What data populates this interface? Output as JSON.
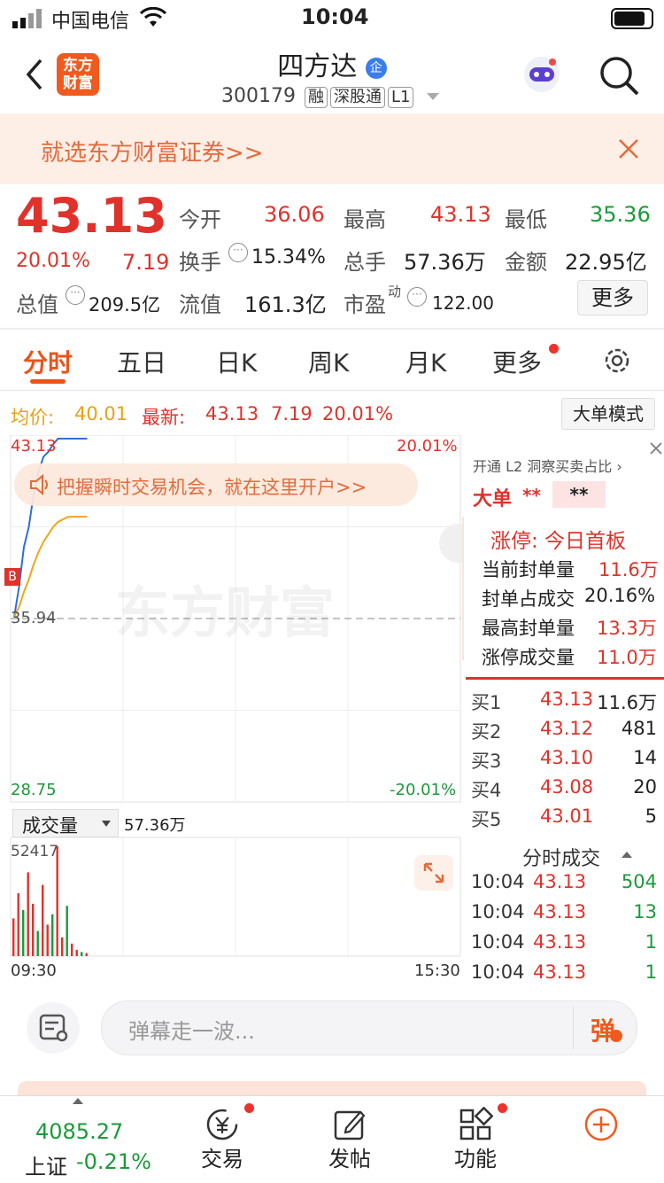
{
  "status": {
    "carrier": "中国电信",
    "time": "10:04"
  },
  "header": {
    "logo_line1": "东方",
    "logo_line2": "财富",
    "stock_name": "四方达",
    "badge": "企",
    "code": "300179",
    "chips": [
      "融",
      "深股通",
      "L1"
    ]
  },
  "banner": {
    "text": "就选东方财富证券>>"
  },
  "quote": {
    "price": "43.13",
    "pct": "20.01%",
    "change": "7.19",
    "open_label": "今开",
    "open": "36.06",
    "high_label": "最高",
    "high": "43.13",
    "low_label": "最低",
    "low": "35.36",
    "turnover_label": "换手",
    "turnover": "15.34%",
    "vol_label": "总手",
    "vol": "57.36万",
    "amount_label": "金额",
    "amount": "22.95亿",
    "mktcap_label": "总值",
    "mktcap": "209.5亿",
    "float_label": "流值",
    "float": "161.3亿",
    "pe_label": "市盈",
    "pe_sup": "动",
    "pe": "122.00",
    "more": "更多"
  },
  "tabs": [
    "分时",
    "五日",
    "日K",
    "周K",
    "月K",
    "更多"
  ],
  "info": {
    "avg_label": "均价:",
    "avg": "40.01",
    "latest_label": "最新:",
    "latest": "43.13",
    "latest_chg": "7.19",
    "latest_pct": "20.01%",
    "mode_button": "大单模式"
  },
  "chart": {
    "top_price": "43.13",
    "top_pct": "20.01%",
    "mid_price": "35.94",
    "bottom_price": "28.75",
    "bottom_pct": "-20.01%",
    "ad_text": "把握瞬时交易机会，就在这里开户>>",
    "watermark": "东方财富",
    "b_marker": "B",
    "volume_selector": "成交量",
    "volume_total": "57.36万",
    "volume_max": "52417",
    "time_start": "09:30",
    "time_end": "15:30"
  },
  "chart_data": {
    "type": "line",
    "x": [
      "09:30",
      "09:31",
      "09:32",
      "09:33",
      "09:34",
      "09:35",
      "09:36",
      "09:37",
      "09:38",
      "09:39",
      "09:40",
      "09:41",
      "09:42",
      "09:43",
      "09:44",
      "09:45"
    ],
    "ylim": [
      28.75,
      43.13
    ],
    "series": [
      {
        "color": "#2c6fd6",
        "values": [
          36.0,
          37.2,
          38.8,
          39.6,
          40.9,
          41.8,
          42.4,
          42.6,
          42.9,
          43.13,
          43.13,
          43.13,
          43.13,
          43.13,
          43.13,
          43.13
        ]
      },
      {
        "color": "#f2a516",
        "values": [
          36.0,
          36.4,
          37.0,
          37.5,
          38.1,
          38.6,
          39.0,
          39.3,
          39.6,
          39.8,
          39.9,
          40.0,
          40.01,
          40.01,
          40.01,
          40.01
        ]
      }
    ],
    "volume": {
      "ylim": [
        0,
        52417
      ],
      "values": [
        18000,
        30000,
        22000,
        40000,
        25000,
        12000,
        34000,
        15000,
        20000,
        52417,
        9000,
        24000,
        6000,
        3000,
        2000,
        1500
      ]
    }
  },
  "l2": {
    "header": "开通 L2 洞察买卖占比",
    "big_order": "大单",
    "stars1": "**",
    "stars2": "**",
    "limit_title": "涨停: 今日首板",
    "rows": [
      {
        "label": "当前封单量",
        "value": "11.6万"
      },
      {
        "label": "封单占成交",
        "value": "20.16%"
      },
      {
        "label": "最高封单量",
        "value": "13.3万"
      },
      {
        "label": "涨停成交量",
        "value": "11.0万"
      }
    ],
    "bids": [
      {
        "label": "买1",
        "price": "43.13",
        "qty": "11.6万"
      },
      {
        "label": "买2",
        "price": "43.12",
        "qty": "481"
      },
      {
        "label": "买3",
        "price": "43.10",
        "qty": "14"
      },
      {
        "label": "买4",
        "price": "43.08",
        "qty": "20"
      },
      {
        "label": "买5",
        "price": "43.01",
        "qty": "5"
      }
    ],
    "trades_title": "分时成交",
    "trades": [
      {
        "time": "10:04",
        "price": "43.13",
        "qty": "504"
      },
      {
        "time": "10:04",
        "price": "43.13",
        "qty": "13"
      },
      {
        "time": "10:04",
        "price": "43.13",
        "qty": "1"
      },
      {
        "time": "10:04",
        "price": "43.13",
        "qty": "1"
      }
    ]
  },
  "input": {
    "placeholder": "弹幕走一波...",
    "danmu_button": "弹"
  },
  "nav": {
    "index_value": "4085.27",
    "index_name": "上证",
    "index_pct": "-0.21%",
    "trade": "交易",
    "post": "发帖",
    "func": "功能"
  },
  "colors": {
    "up": "#e0322b",
    "down": "#1a9a3a",
    "accent": "#f05a1e"
  }
}
